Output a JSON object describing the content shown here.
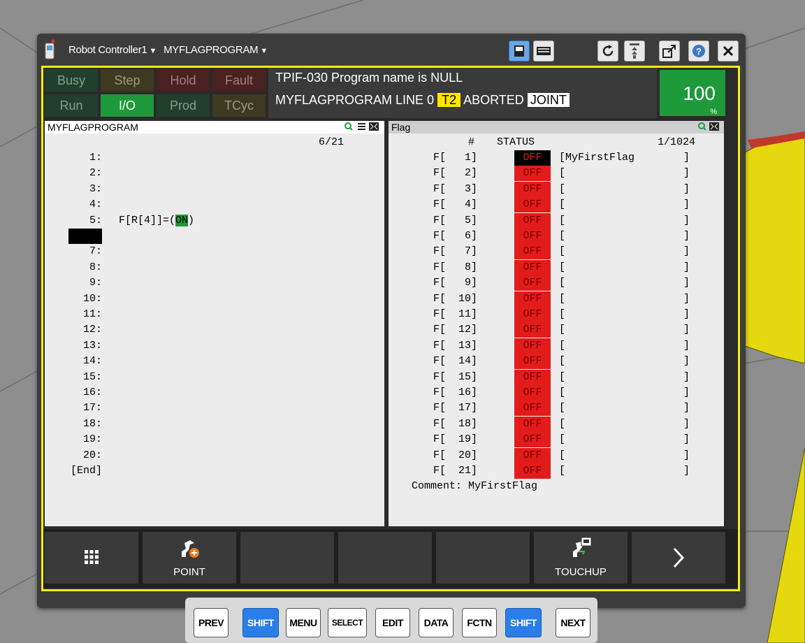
{
  "titlebar": {
    "controller": "Robot Controller1",
    "program": "MYFLAGPROGRAM",
    "icons": [
      "teach-pendant-icon",
      "tp-screen-icon",
      "keyboard-icon",
      "refresh-icon",
      "tool-icon",
      "external-window-icon",
      "help-icon",
      "close-icon"
    ]
  },
  "status": {
    "buttons": [
      {
        "label": "Busy",
        "active": false
      },
      {
        "label": "Step",
        "active": false
      },
      {
        "label": "Hold",
        "active": false
      },
      {
        "label": "Fault",
        "active": false
      },
      {
        "label": "Run",
        "active": false
      },
      {
        "label": "I/O",
        "active": true
      },
      {
        "label": "Prod",
        "active": false
      },
      {
        "label": "TCyc",
        "active": false
      }
    ],
    "message": "TPIF-030  Program name is NULL",
    "line_program": "MYFLAGPROGRAM LINE 0",
    "mode": "T2",
    "state": "ABORTED",
    "coord": "JOINT",
    "override": "100",
    "override_unit": "%"
  },
  "editor": {
    "title": "MYFLAGPROGRAM",
    "position": "6/21",
    "cursor_line": 6,
    "lines": [
      {
        "num": "1:",
        "code": ""
      },
      {
        "num": "2:",
        "code": ""
      },
      {
        "num": "3:",
        "code": ""
      },
      {
        "num": "4:",
        "code": ""
      },
      {
        "num": "5:",
        "code": "F[R[4]]=(ON)"
      },
      {
        "num": "6:",
        "code": ""
      },
      {
        "num": "7:",
        "code": ""
      },
      {
        "num": "8:",
        "code": ""
      },
      {
        "num": "9:",
        "code": ""
      },
      {
        "num": "10:",
        "code": ""
      },
      {
        "num": "11:",
        "code": ""
      },
      {
        "num": "12:",
        "code": ""
      },
      {
        "num": "13:",
        "code": ""
      },
      {
        "num": "14:",
        "code": ""
      },
      {
        "num": "15:",
        "code": ""
      },
      {
        "num": "16:",
        "code": ""
      },
      {
        "num": "17:",
        "code": ""
      },
      {
        "num": "18:",
        "code": ""
      },
      {
        "num": "19:",
        "code": ""
      },
      {
        "num": "20:",
        "code": ""
      },
      {
        "num": "[End]",
        "code": ""
      }
    ]
  },
  "flag": {
    "title": "Flag",
    "col_num": "#",
    "col_status": "STATUS",
    "position": "1/1024",
    "rows": [
      {
        "n": "1",
        "status": "OFF",
        "comment": "MyFirstFlag"
      },
      {
        "n": "2",
        "status": "OFF",
        "comment": ""
      },
      {
        "n": "3",
        "status": "OFF",
        "comment": ""
      },
      {
        "n": "4",
        "status": "OFF",
        "comment": ""
      },
      {
        "n": "5",
        "status": "OFF",
        "comment": ""
      },
      {
        "n": "6",
        "status": "OFF",
        "comment": ""
      },
      {
        "n": "7",
        "status": "OFF",
        "comment": ""
      },
      {
        "n": "8",
        "status": "OFF",
        "comment": ""
      },
      {
        "n": "9",
        "status": "OFF",
        "comment": ""
      },
      {
        "n": "10",
        "status": "OFF",
        "comment": ""
      },
      {
        "n": "11",
        "status": "OFF",
        "comment": ""
      },
      {
        "n": "12",
        "status": "OFF",
        "comment": ""
      },
      {
        "n": "13",
        "status": "OFF",
        "comment": ""
      },
      {
        "n": "14",
        "status": "OFF",
        "comment": ""
      },
      {
        "n": "15",
        "status": "OFF",
        "comment": ""
      },
      {
        "n": "16",
        "status": "OFF",
        "comment": ""
      },
      {
        "n": "17",
        "status": "OFF",
        "comment": ""
      },
      {
        "n": "18",
        "status": "OFF",
        "comment": ""
      },
      {
        "n": "19",
        "status": "OFF",
        "comment": ""
      },
      {
        "n": "20",
        "status": "OFF",
        "comment": ""
      },
      {
        "n": "21",
        "status": "OFF",
        "comment": ""
      }
    ],
    "comment": "Comment: MyFirstFlag"
  },
  "funckeys": [
    {
      "label": "",
      "icon": "grid-menu-icon"
    },
    {
      "label": "POINT",
      "icon": "robot-add-point-icon"
    },
    {
      "label": "",
      "icon": ""
    },
    {
      "label": "",
      "icon": ""
    },
    {
      "label": "",
      "icon": ""
    },
    {
      "label": "TOUCHUP",
      "icon": "robot-touchup-icon"
    },
    {
      "label": "",
      "icon": "chevron-right-icon"
    }
  ],
  "keypad": [
    {
      "label": "PREV",
      "style": "white"
    },
    {
      "label": "SHIFT",
      "style": "blue"
    },
    {
      "label": "MENU",
      "style": "white"
    },
    {
      "label": "SELECT",
      "style": "white"
    },
    {
      "label": "EDIT",
      "style": "white"
    },
    {
      "label": "DATA",
      "style": "white"
    },
    {
      "label": "FCTN",
      "style": "white"
    },
    {
      "label": "SHIFT",
      "style": "blue"
    },
    {
      "label": "NEXT",
      "style": "white"
    }
  ]
}
